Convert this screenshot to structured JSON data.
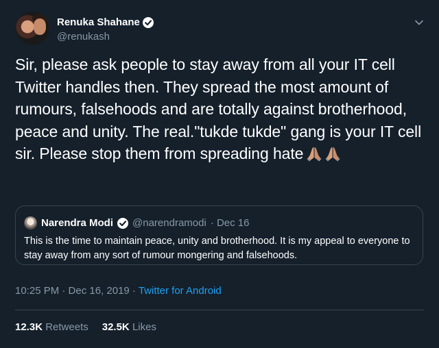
{
  "author": {
    "display_name": "Renuka Shahane",
    "handle": "@renukash",
    "verified": true
  },
  "tweet": {
    "text": "Sir, please ask people to stay away from all your IT cell Twitter handles then. They spread the most amount of rumours, falsehoods and are totally against brotherhood, peace and unity. The real.\"tukde tukde\" gang is your IT cell sir. Please stop them from spreading hate",
    "emoji": "folded-hands-icon x2"
  },
  "quoted_tweet": {
    "display_name": "Narendra Modi",
    "handle": "@narendramodi",
    "date": "· Dec 16",
    "text": "This is the time to maintain peace, unity and brotherhood. It is my appeal to everyone to stay away from any sort of rumour mongering and falsehoods."
  },
  "meta": {
    "timestamp": "10:25 PM · Dec 16, 2019 · ",
    "source": "Twitter for Android"
  },
  "stats": {
    "retweets_count": "12.3K",
    "retweets_label": "Retweets",
    "likes_count": "32.5K",
    "likes_label": "Likes"
  },
  "colors": {
    "background": "#15202b",
    "secondary_text": "#8899a6",
    "accent": "#1da1f2",
    "border": "#38444d"
  }
}
